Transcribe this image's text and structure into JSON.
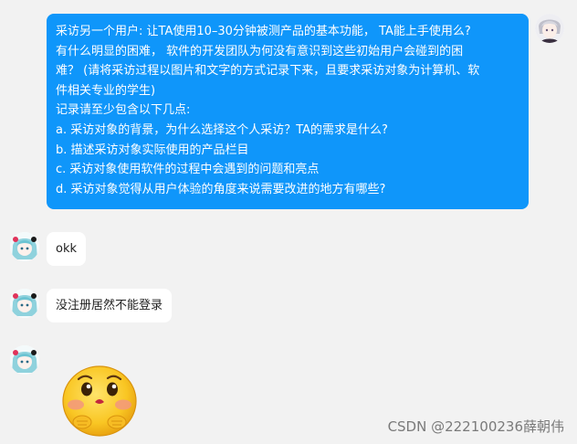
{
  "messages": {
    "outgoing": {
      "lines": [
        "采访另一个用户: 让TA使用10–30分钟被测产品的基本功能， TA能上手使用么?",
        "有什么明显的困难， 软件的开发团队为何没有意识到这些初始用户会碰到的困",
        "难？ (请将采访过程以图片和文字的方式记录下来，且要求采访对象为计算机、软",
        "件相关专业的学生)",
        "记录请至少包含以下几点:",
        "a. 采访对象的背景，为什么选择这个人采访？TA的需求是什么?",
        "b. 描述采访对象实际使用的产品栏目",
        "c. 采访对象使用软件的过程中会遇到的问题和亮点",
        "d. 采访对象觉得从用户体验的角度来说需要改进的地方有哪些?"
      ]
    },
    "reply_1": "okk",
    "reply_2": "没注册居然不能登录"
  },
  "watermark": "CSDN @222100236薛朝伟",
  "colors": {
    "outgoing_bubble": "#0f96fa",
    "background": "#f2f2f2",
    "incoming_bubble": "#ffffff"
  },
  "icons": {
    "self_avatar": "anime-character-avatar",
    "peer_avatar": "anime-character-avatar",
    "sticker": "blushing-face-emoji"
  }
}
